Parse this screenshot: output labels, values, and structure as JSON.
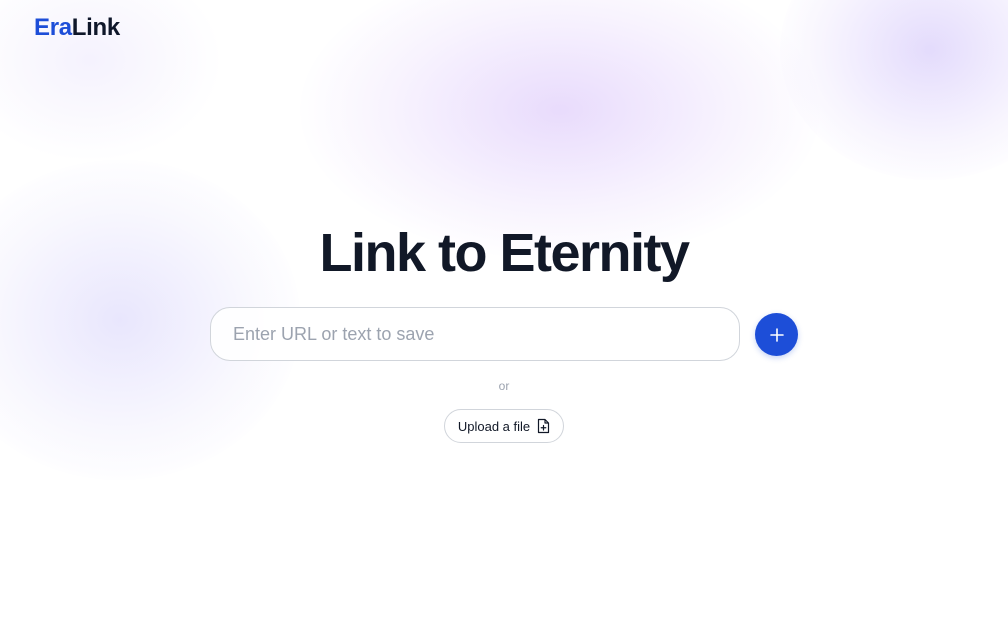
{
  "brand": {
    "name_part1": "Era",
    "name_part2": "Link",
    "accent_color": "#1d4ed8",
    "text_color": "#0f172a"
  },
  "hero": {
    "title": "Link to Eternity"
  },
  "input": {
    "placeholder": "Enter URL or text to save",
    "value": ""
  },
  "actions": {
    "add_icon": "plus-icon",
    "divider_text": "or",
    "upload_label": "Upload a file",
    "upload_icon": "file-plus-icon"
  }
}
